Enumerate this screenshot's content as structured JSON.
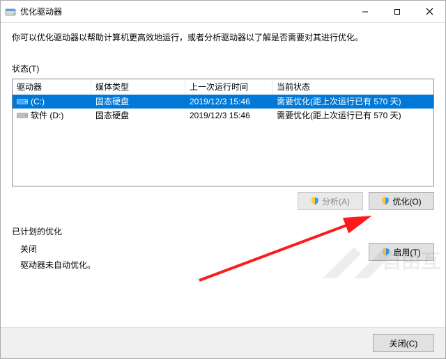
{
  "window": {
    "title": "优化驱动器"
  },
  "description": "你可以优化驱动器以帮助计算机更高效地运行，或者分析驱动器以了解是否需要对其进行优化。",
  "status_label": "状态(T)",
  "columns": {
    "drive": "驱动器",
    "media": "媒体类型",
    "last": "上一次运行时间",
    "state": "当前状态"
  },
  "drives": [
    {
      "name": "(C:)",
      "icon": "drive-os",
      "media": "固态硬盘",
      "last": "2019/12/3 15:46",
      "state": "需要优化(距上次运行已有 570 天)",
      "selected": true
    },
    {
      "name": "软件 (D:)",
      "icon": "drive",
      "media": "固态硬盘",
      "last": "2019/12/3 15:46",
      "state": "需要优化(距上次运行已有 570 天)",
      "selected": false
    }
  ],
  "buttons": {
    "analyze": "分析(A)",
    "optimize": "优化(O)",
    "enable": "启用(T)",
    "close": "关闭(C)"
  },
  "schedule": {
    "section_title": "已计划的优化",
    "status": "关闭",
    "note": "驱动器未自动优化。"
  }
}
